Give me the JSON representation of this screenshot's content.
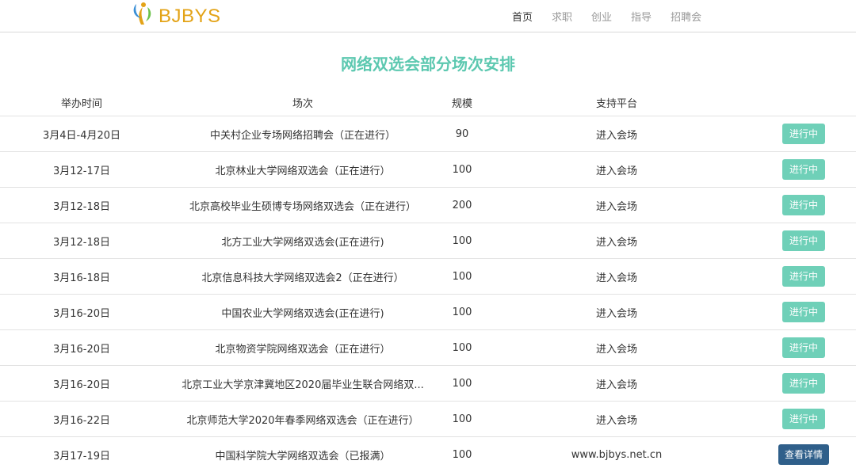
{
  "header": {
    "logo_text": "BJBYS",
    "nav": [
      {
        "label": "首页",
        "active": true
      },
      {
        "label": "求职",
        "active": false
      },
      {
        "label": "创业",
        "active": false
      },
      {
        "label": "指导",
        "active": false
      },
      {
        "label": "招聘会",
        "active": false
      }
    ]
  },
  "main": {
    "title": "网络双选会部分场次安排",
    "columns": [
      "举办时间",
      "场次",
      "规模",
      "支持平台",
      ""
    ],
    "rows": [
      {
        "date": "3月4日-4月20日",
        "name": "中关村企业专场网络招聘会（正在进行）",
        "scale": "90",
        "platform": "进入会场",
        "action": "进行中",
        "status": "going"
      },
      {
        "date": "3月12-17日",
        "name": "北京林业大学网络双选会（正在进行）",
        "scale": "100",
        "platform": "进入会场",
        "action": "进行中",
        "status": "going"
      },
      {
        "date": "3月12-18日",
        "name": "北京高校毕业生硕博专场网络双选会（正在进行）",
        "scale": "200",
        "platform": "进入会场",
        "action": "进行中",
        "status": "going"
      },
      {
        "date": "3月12-18日",
        "name": "北方工业大学网络双选会(正在进行)",
        "scale": "100",
        "platform": "进入会场",
        "action": "进行中",
        "status": "going"
      },
      {
        "date": "3月16-18日",
        "name": "北京信息科技大学网络双选会2（正在进行）",
        "scale": "100",
        "platform": "进入会场",
        "action": "进行中",
        "status": "going"
      },
      {
        "date": "3月16-20日",
        "name": "中国农业大学网络双选会(正在进行)",
        "scale": "100",
        "platform": "进入会场",
        "action": "进行中",
        "status": "going"
      },
      {
        "date": "3月16-20日",
        "name": "北京物资学院网络双选会（正在进行）",
        "scale": "100",
        "platform": "进入会场",
        "action": "进行中",
        "status": "going"
      },
      {
        "date": "3月16-20日",
        "name": "北京工业大学京津冀地区2020届毕业生联合网络双...",
        "scale": "100",
        "platform": "进入会场",
        "action": "进行中",
        "status": "going"
      },
      {
        "date": "3月16-22日",
        "name": "北京师范大学2020年春季网络双选会（正在进行）",
        "scale": "100",
        "platform": "进入会场",
        "action": "进行中",
        "status": "going"
      },
      {
        "date": "3月17-19日",
        "name": "中国科学院大学网络双选会（已报满）",
        "scale": "100",
        "platform": "www.bjbys.net.cn",
        "action": "查看详情",
        "status": "full"
      }
    ]
  },
  "colors": {
    "accent": "#5cc8b0",
    "button_going": "#6fd0b8",
    "button_full": "#2f5f8a",
    "logo": "#e3a317"
  }
}
